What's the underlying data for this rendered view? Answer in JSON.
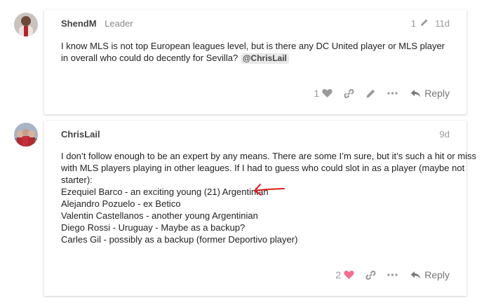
{
  "posts": [
    {
      "username": "ShendM",
      "user_title": "Leader",
      "edit_count": "1",
      "date": "11d",
      "body_text": "I know MLS is not top European leagues level, but is there any DC United player or MLS player in overall who could do decently for Sevilla?",
      "mention": "@ChrisLail",
      "likes": "1",
      "reply_label": "Reply",
      "icons": [
        "heart-icon",
        "link-icon",
        "pencil-icon",
        "ellipsis-icon",
        "reply-arrow-icon"
      ],
      "heart_color": "#999999"
    },
    {
      "username": "ChrisLail",
      "date": "9d",
      "body_lines": [
        "I don’t follow enough to be an expert by any means. There are some I’m sure, but it’s such a hit or miss",
        "with MLS players playing in other leagues. If I had to guess who could slot in as a player (maybe not",
        "starter):",
        "Ezequiel Barco - an exciting young (21) Argentinian",
        "Alejandro Pozuelo - ex Betico",
        "Valentin Castellanos - another young Argentinian",
        "Diego Rossi - Uruguay - Maybe as a backup?",
        "Carles Gil - possibly as a backup (former Deportivo player)"
      ],
      "likes": "2",
      "reply_label": "Reply",
      "icons": [
        "heart-icon",
        "link-icon",
        "ellipsis-icon",
        "reply-arrow-icon"
      ],
      "heart_color": "#fa6c8d",
      "annotation": "red-arrow-icon"
    }
  ]
}
